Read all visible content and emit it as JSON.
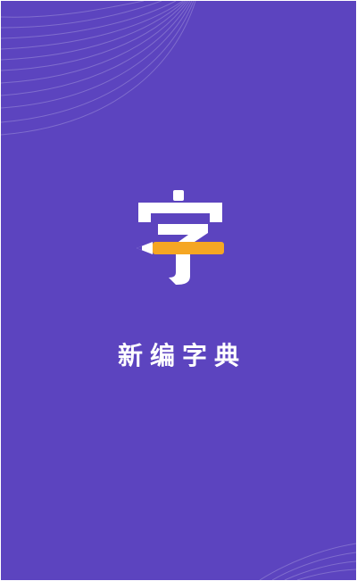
{
  "app": {
    "name": "新编字典",
    "logo_char": "字"
  },
  "colors": {
    "background": "#5c44bf",
    "logo_white": "#ffffff",
    "pencil_body": "#f5a623",
    "pencil_tip": "#ffffff"
  },
  "icons": {
    "logo": "character-with-pencil-icon"
  }
}
